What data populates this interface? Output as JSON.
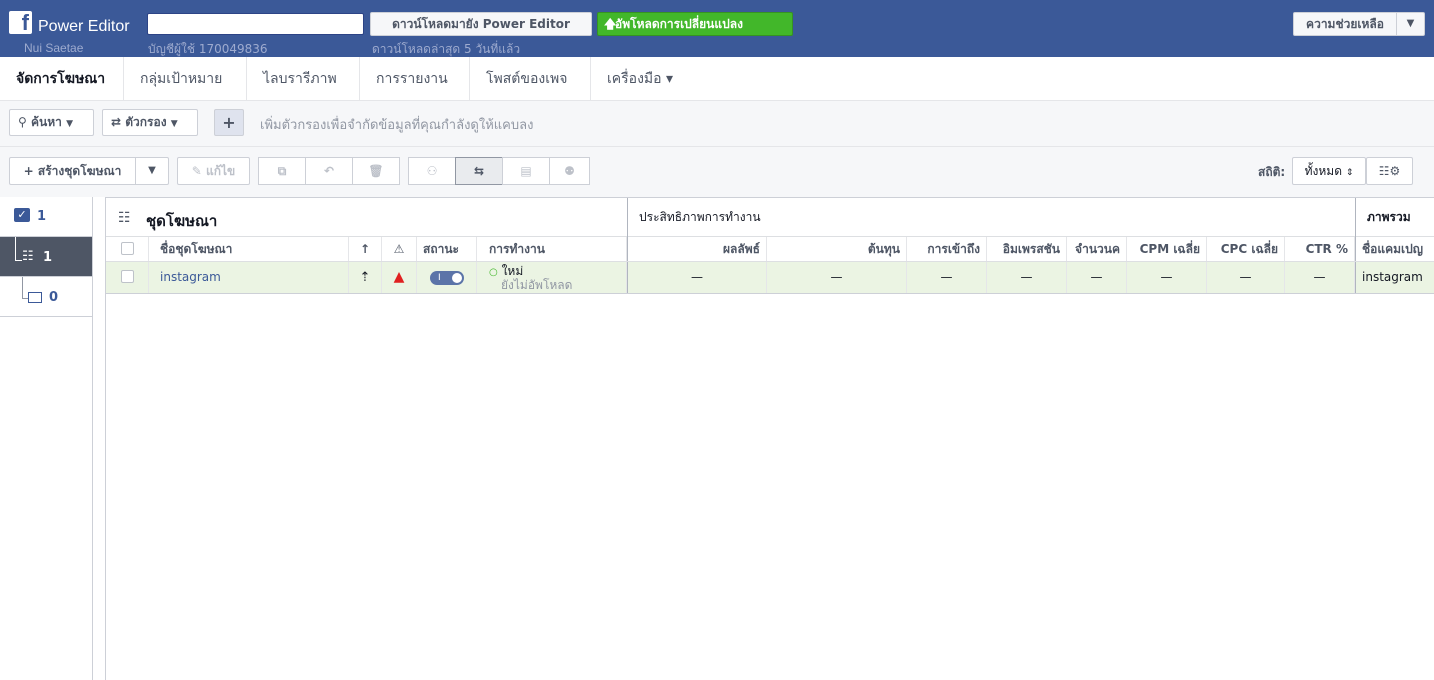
{
  "topbar": {
    "brand_glyph": "f",
    "app_title": "Power Editor",
    "user_name": "Nui Saetae",
    "account_id": "บัญชีผู้ใช้ 170049836",
    "download_label": "ดาวน์โหลดมายัง Power Editor",
    "last_download": "ดาวน์โหลดล่าสุด 5 วันที่แล้ว",
    "upload_label": "อัพโหลดการเปลี่ยนแปลง",
    "help_label": "ความช่วยเหลือ"
  },
  "nav": {
    "items": [
      {
        "label": "จัดการโฆษณา"
      },
      {
        "label": "กลุ่มเป้าหมาย"
      },
      {
        "label": "ไลบรารีภาพ"
      },
      {
        "label": "การรายงาน"
      },
      {
        "label": "โพสต์ของเพจ"
      },
      {
        "label": "เครื่องมือ ▾"
      }
    ]
  },
  "filterbar": {
    "search_label": "ค้นหา",
    "filter_label": "ตัวกรอง",
    "add_label": "+",
    "hint": "เพิ่มตัวกรองเพื่อจำกัดข้อมูลที่คุณกำลังดูให้แคบลง"
  },
  "toolbar": {
    "create_label": "สร้างชุดโฆษณา",
    "edit_label": "แก้ไข",
    "stats_label": "สถิติ:",
    "stats_value": "ทั้งหมด"
  },
  "tree": {
    "campaigns_count": "1",
    "adsets_count": "1",
    "ads_count": "0"
  },
  "table": {
    "title": "ชุดโฆษณา",
    "group_performance": "ประสิทธิภาพการทำงาน",
    "group_overview": "ภาพรวม",
    "columns": {
      "name": "ชื่อชุดโฆษณา",
      "status": "สถานะ",
      "delivery": "การทำงาน",
      "results": "ผลลัพธ์",
      "cost": "ต้นทุน",
      "reach": "การเข้าถึง",
      "impressions": "อิมเพรสชัน",
      "clicks": "จำนวนค",
      "cpm": "CPM เฉลี่ย",
      "cpc": "CPC เฉลี่ย",
      "ctr": "CTR %",
      "campaign": "ชื่อแคมเปญ"
    },
    "row": {
      "name": "instagram",
      "delivery_status": "ใหม่",
      "delivery_sub": "ยังไม่อัพโหลด",
      "toggle_label": "I",
      "results": "—",
      "cost": "—",
      "reach": "—",
      "impressions": "—",
      "clicks": "—",
      "cpm": "—",
      "cpc": "—",
      "ctr": "—",
      "campaign": "instagram"
    }
  },
  "colors": {
    "brand": "#3b5998",
    "upload_green": "#42b72a",
    "row_highlight": "#ebf4e3",
    "warning_red": "#e02020"
  }
}
